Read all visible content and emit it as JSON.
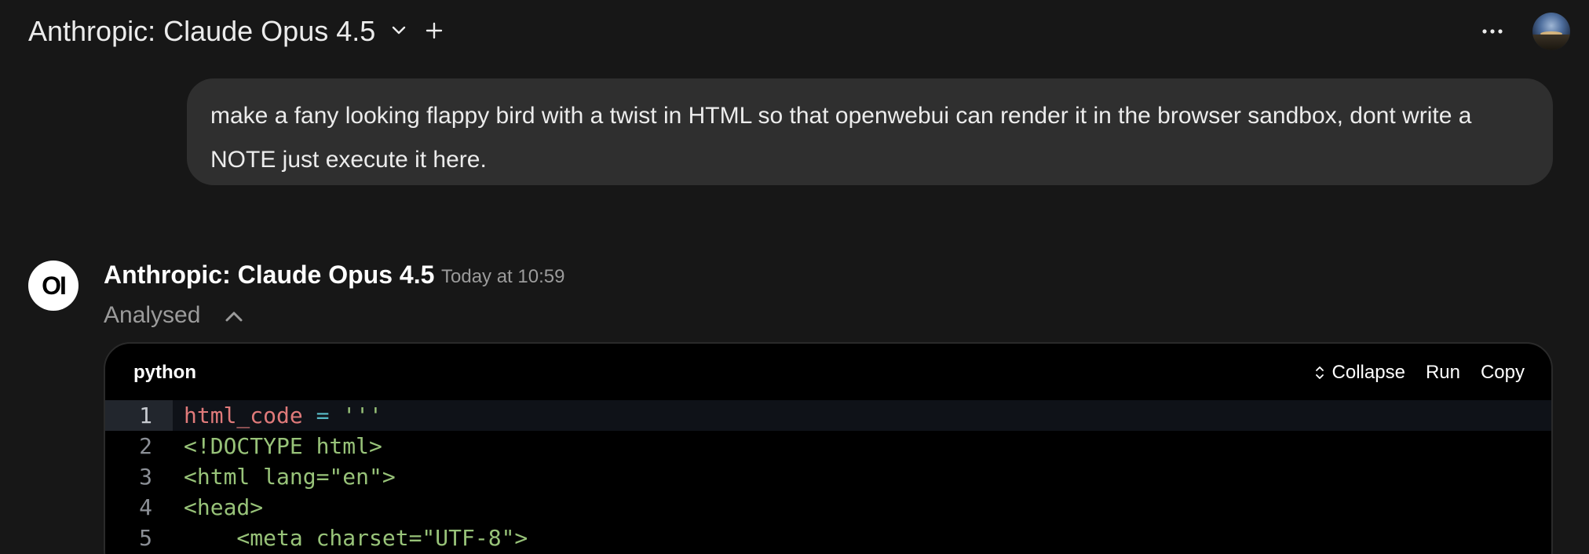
{
  "header": {
    "model_title": "Anthropic: Claude Opus 4.5",
    "icons": [
      "chevron-down-icon",
      "plus-icon",
      "more-icon",
      "avatar"
    ]
  },
  "user_message": {
    "text": "make a fany looking flappy bird with a twist in HTML so that openwebui can render it in the browser sandbox, dont write a NOTE just execute it here."
  },
  "assistant_message": {
    "logo_text": "OI",
    "name": "Anthropic: Claude Opus 4.5",
    "timestamp": "Today at 10:59",
    "status_label": "Analysed"
  },
  "code_block": {
    "language": "python",
    "actions": {
      "collapse": "Collapse",
      "run": "Run",
      "copy": "Copy"
    },
    "lines": [
      {
        "num": "1",
        "var": "html_code",
        "op": " = ",
        "str": "'''"
      },
      {
        "num": "2",
        "code": "<!DOCTYPE html>"
      },
      {
        "num": "3",
        "code": "<html lang=\"en\">"
      },
      {
        "num": "4",
        "code": "<head>"
      },
      {
        "num": "5",
        "code": "    <meta charset=\"UTF-8\">"
      }
    ]
  },
  "colors": {
    "background": "#171717",
    "bubble": "#2f2f2f",
    "code_bg": "#000000",
    "code_var": "#e07a7a",
    "code_op": "#56b6c2",
    "code_str": "#98c379"
  }
}
